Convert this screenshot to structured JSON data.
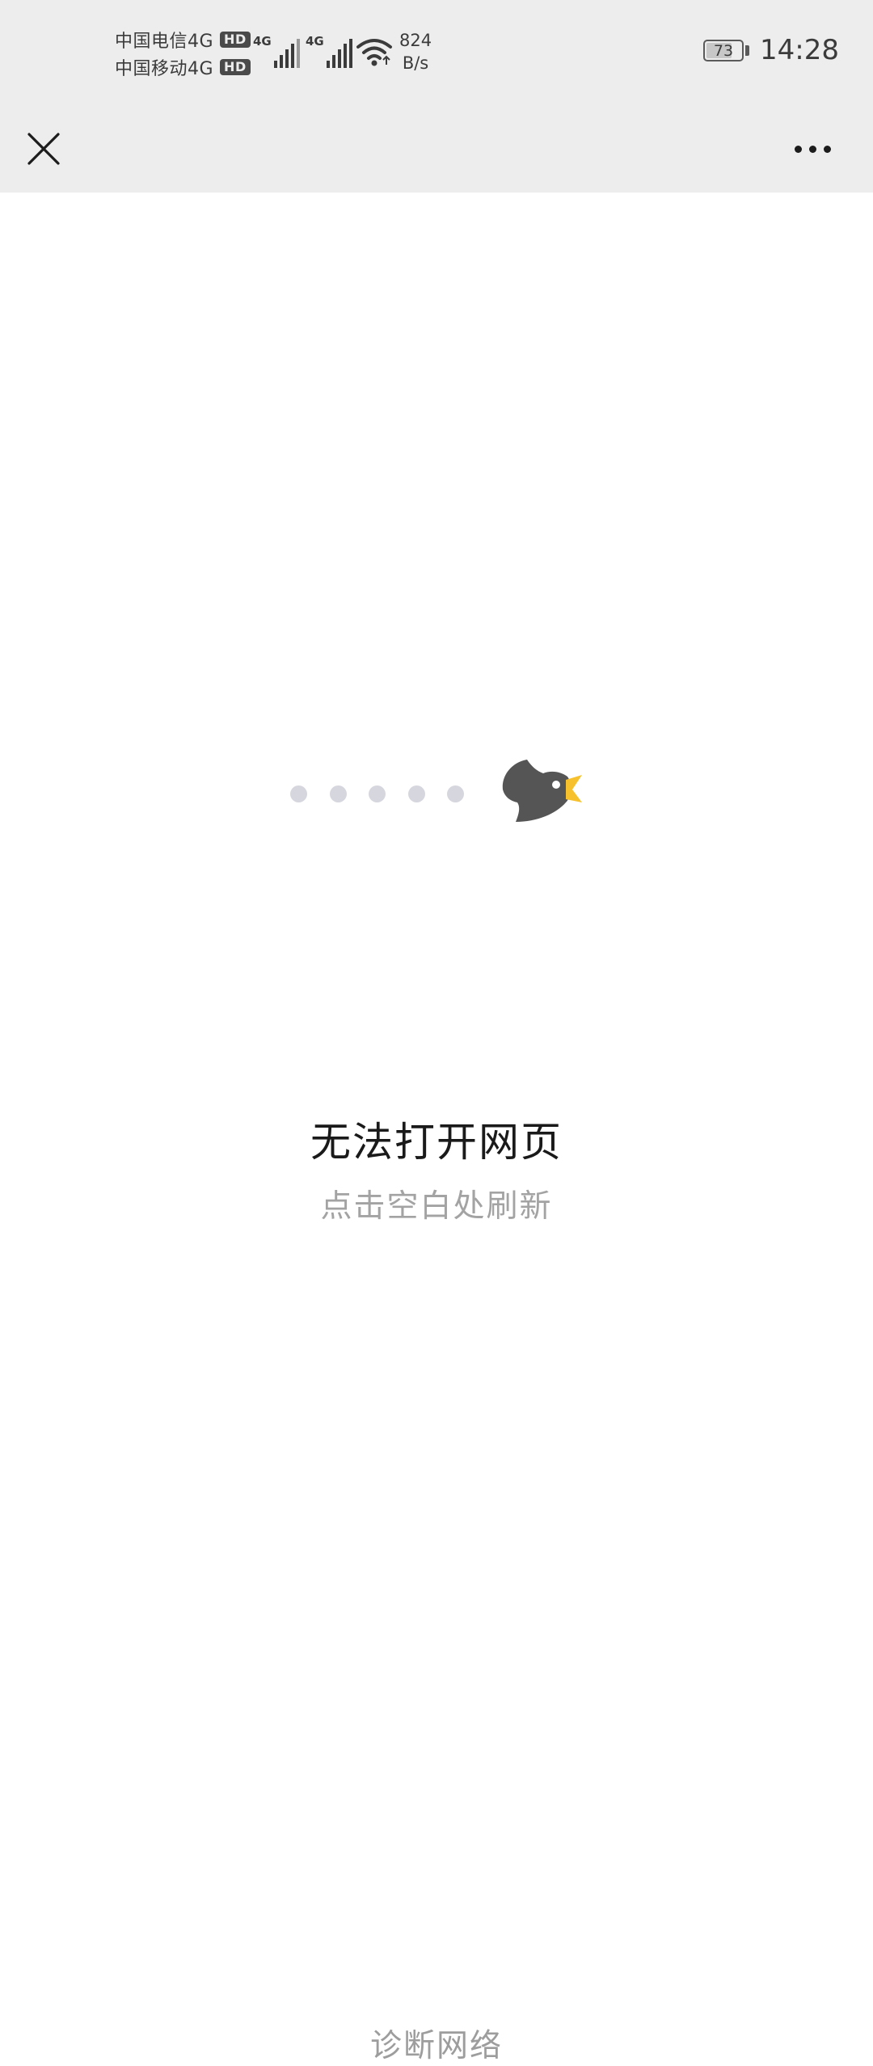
{
  "status_bar": {
    "carrier_1": "中国电信4G",
    "carrier_2": "中国移动4G",
    "hd_badge": "HD",
    "network_type_1": "4G",
    "network_type_2": "4G",
    "net_speed_value": "824",
    "net_speed_unit": "B/s",
    "battery_level": "73",
    "time": "14:28",
    "icons": [
      "signal-icon",
      "wifi-icon",
      "battery-icon"
    ]
  },
  "nav_bar": {
    "icons": [
      "close-icon",
      "more-icon"
    ]
  },
  "error_page": {
    "title": "无法打开网页",
    "subtitle": "点击空白处刷新",
    "diagnose_link": "诊断网络",
    "illustration": "bird-icon",
    "colors": {
      "bird_body": "#555555",
      "bird_beak": "#f6c12c",
      "trail_dots": "#d6d6de"
    }
  }
}
